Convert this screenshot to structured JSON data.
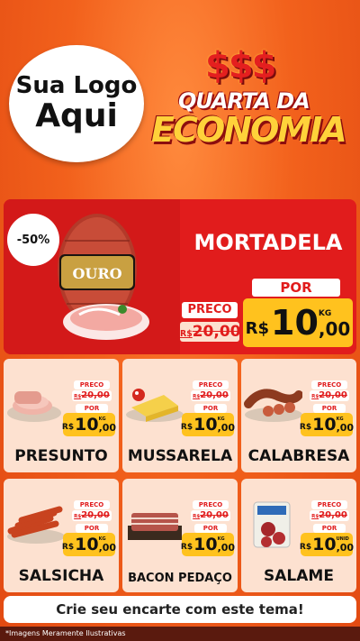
{
  "logo": {
    "line1": "Sua Logo",
    "line2": "Aqui"
  },
  "header": {
    "dollars": "$$$",
    "title_line1": "QUARTA DA",
    "title_line2": "ECONOMIA"
  },
  "featured": {
    "discount": "-50%",
    "brand_text": "OURO",
    "name": "MORTADELA",
    "preco_label": "PRECO",
    "old_currency": "R$",
    "old_price": "20,00",
    "por_label": "POR",
    "currency": "R$",
    "price_int": "10",
    "price_dec": ",00",
    "unit": "KG"
  },
  "products": [
    {
      "name": "PRESUNTO",
      "preco_label": "PRECO",
      "old_currency": "R$",
      "old_price": "20,00",
      "por_label": "POR",
      "currency": "R$",
      "price_int": "10",
      "price_dec": ",00",
      "unit": "KG",
      "icon": "ham-slices-icon"
    },
    {
      "name": "MUSSARELA",
      "preco_label": "PRECO",
      "old_currency": "R$",
      "old_price": "20,00",
      "por_label": "POR",
      "currency": "R$",
      "price_int": "10",
      "price_dec": ",00",
      "unit": "KG",
      "icon": "cheese-icon"
    },
    {
      "name": "CALABRESA",
      "preco_label": "PRECO",
      "old_currency": "R$",
      "old_price": "20,00",
      "por_label": "POR",
      "currency": "R$",
      "price_int": "10",
      "price_dec": ",00",
      "unit": "KG",
      "icon": "sausage-icon"
    },
    {
      "name": "SALSICHA",
      "preco_label": "PRECO",
      "old_currency": "R$",
      "old_price": "20,00",
      "por_label": "POR",
      "currency": "R$",
      "price_int": "10",
      "price_dec": ",00",
      "unit": "KG",
      "icon": "hotdog-icon"
    },
    {
      "name": "BACON PEDAÇO",
      "preco_label": "PRECO",
      "old_currency": "R$",
      "old_price": "20,00",
      "por_label": "POR",
      "currency": "R$",
      "price_int": "10",
      "price_dec": ",00",
      "unit": "KG",
      "icon": "bacon-icon"
    },
    {
      "name": "SALAME",
      "preco_label": "PRECO",
      "old_currency": "R$",
      "old_price": "20,00",
      "por_label": "POR",
      "currency": "R$",
      "price_int": "10",
      "price_dec": ",00",
      "unit": "UNID",
      "icon": "salami-icon"
    }
  ],
  "cta": "Crie seu encarte com este tema!",
  "footer": "*Imagens Meramente Ilustrativas",
  "colors": {
    "background": "#f2611c",
    "featured_bg": "#e11c1c",
    "card_bg": "#fde1d0",
    "price_tag": "#ffc21e"
  }
}
